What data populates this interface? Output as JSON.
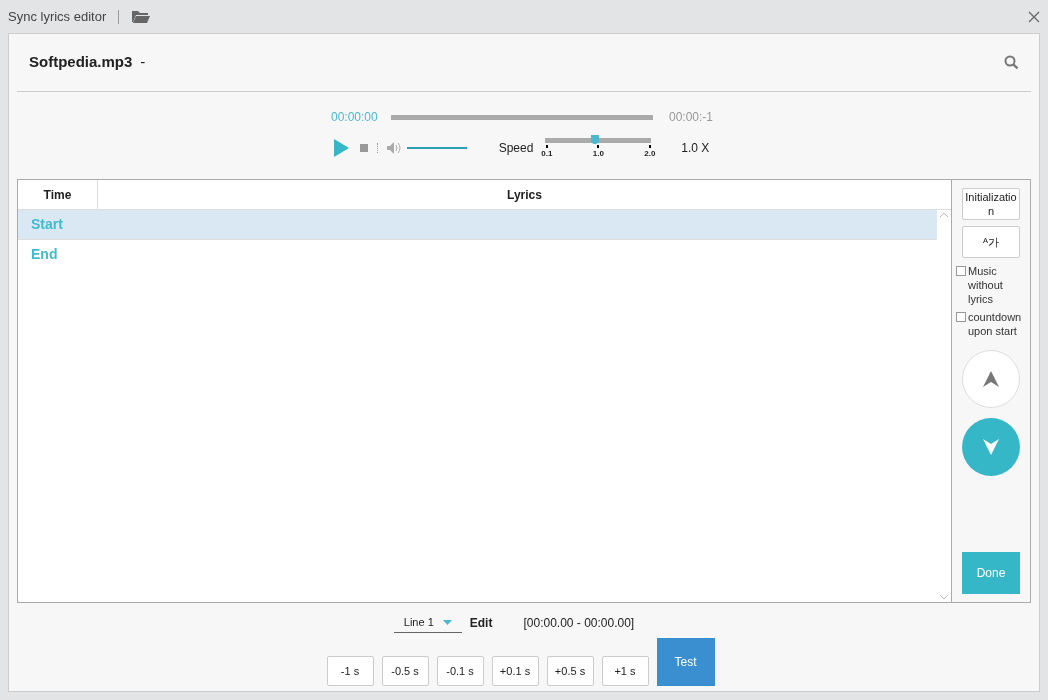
{
  "window": {
    "title": "Sync lyrics editor"
  },
  "file": {
    "name": "Softpedia.mp3",
    "separator": "-"
  },
  "player": {
    "current_time": "00:00:00",
    "total_time": "00:00:-1",
    "progress": {
      "level": 0
    },
    "volume": {
      "level": 1
    },
    "speed_label": "Speed",
    "speed": {
      "level": 0.47
    },
    "speed_ticks": [
      "0.1",
      "1.0",
      "2.0"
    ],
    "speed_value": "1.0 X"
  },
  "table": {
    "columns": [
      "Time",
      "Lyrics"
    ],
    "rows": [
      {
        "time": "Start",
        "selected": true
      },
      {
        "time": "End",
        "selected": false
      }
    ]
  },
  "side": {
    "buttons": [
      "Initialization",
      "ᴬ가"
    ],
    "checkboxes": [
      {
        "label": "Music without lyrics",
        "checked": false
      },
      {
        "label": "countdown upon start",
        "checked": false
      }
    ],
    "done": "Done"
  },
  "bottom": {
    "line_select": "Line 1",
    "edit_label": "Edit",
    "range": "[00:00.00 - 00:00.00]",
    "nudges": [
      "-1 s",
      "-0.5 s",
      "-0.1 s",
      "+0.1 s",
      "+0.5 s",
      "+1 s"
    ],
    "test": "Test"
  }
}
